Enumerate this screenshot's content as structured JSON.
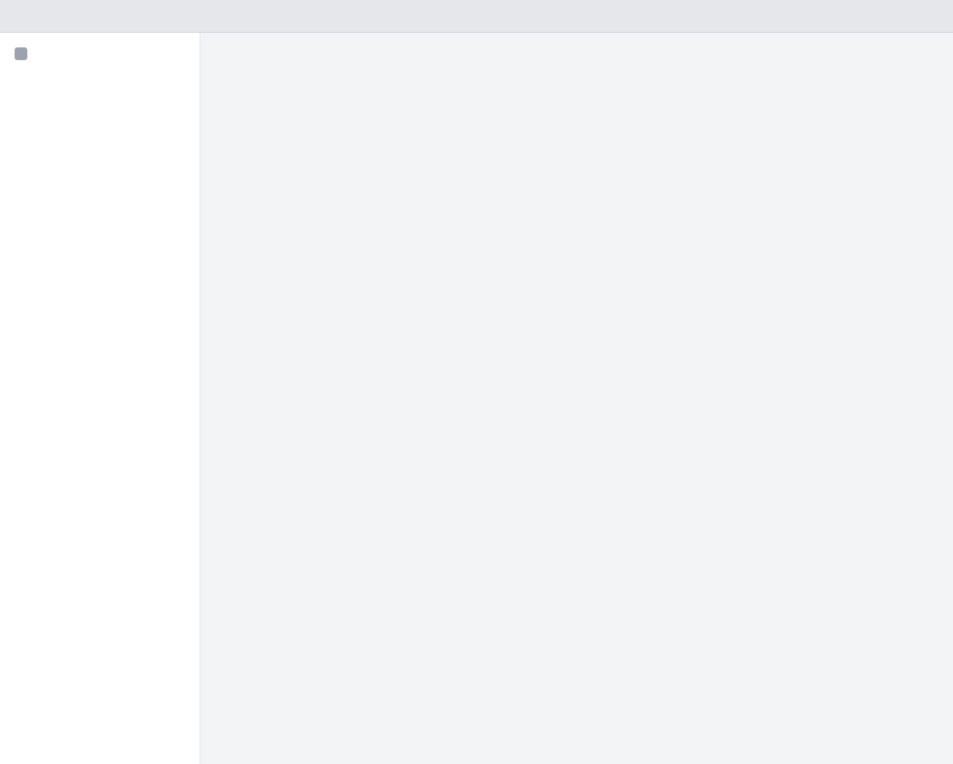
{
  "window": {
    "title": ""
  },
  "sidebar": {
    "items": [
      {
        "label": ""
      }
    ]
  },
  "main": {
    "title": ""
  }
}
